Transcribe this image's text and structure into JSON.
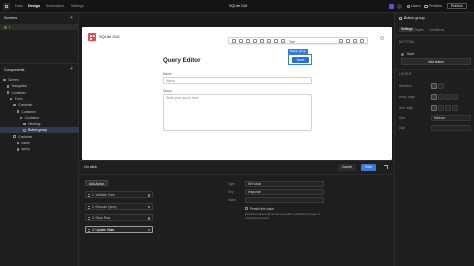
{
  "topbar": {
    "tabs": [
      "Data",
      "Design",
      "Automation",
      "Settings"
    ],
    "active_tab": "Design",
    "app_title": "SQLite GUI",
    "users_label": "Users",
    "preview_label": "Preview",
    "publish_label": "Publish"
  },
  "left": {
    "screens_title": "Screens",
    "screen_item": "/",
    "components_title": "Components",
    "tree": [
      {
        "label": "Screen",
        "indent": 1
      },
      {
        "label": "Navigation",
        "indent": 2
      },
      {
        "label": "Container",
        "indent": 2
      },
      {
        "label": "Form",
        "indent": 3
      },
      {
        "label": "Container",
        "indent": 4
      },
      {
        "label": "Container",
        "indent": 5
      },
      {
        "label": "Container",
        "indent": 6
      },
      {
        "label": "Heading",
        "indent": 7
      },
      {
        "label": "Button group",
        "indent": 7,
        "selected": true
      },
      {
        "label": "Container",
        "indent": 4
      },
      {
        "label": "name",
        "indent": 5
      },
      {
        "label": "query",
        "indent": 5
      }
    ]
  },
  "canvas": {
    "app_name": "SQLite GUI",
    "heading": "Query Editor",
    "name_label": "Name",
    "name_placeholder": "Name",
    "query_label": "Query",
    "query_placeholder": "Write your query here",
    "selection_badge": "Button group",
    "save_button": "Save",
    "toolbar_size_label": "Size"
  },
  "bottom": {
    "title": "On click",
    "cancel_label": "Cancel",
    "save_label": "Save",
    "add_action_label": "Add Action",
    "actions": [
      {
        "label": "1. Validate Form",
        "selected": false
      },
      {
        "label": "2. Execute Query",
        "selected": false
      },
      {
        "label": "3. Save Row",
        "selected": false
      },
      {
        "label": "4. Update State",
        "selected": false,
        "highlight": true
      }
    ],
    "type_label": "Type",
    "type_value": "Set value",
    "key_label": "Key",
    "key_value": "response",
    "value_label": "Value",
    "persist_label": "Persist this value",
    "persist_note": "Persisted values will remain even after reloading the page or closing the browser."
  },
  "right": {
    "component_name": "Button group",
    "tabs": [
      "Settings",
      "Styles",
      "Conditions"
    ],
    "active_tab": "Settings",
    "buttons_title": "BUTTONS",
    "button_item": "Save",
    "add_button_label": "Add button",
    "layout_title": "LAYOUT",
    "rows": [
      "Direction",
      "Horiz. align",
      "Vert. align",
      "Size",
      "Gap"
    ],
    "size_value": "Medium"
  }
}
